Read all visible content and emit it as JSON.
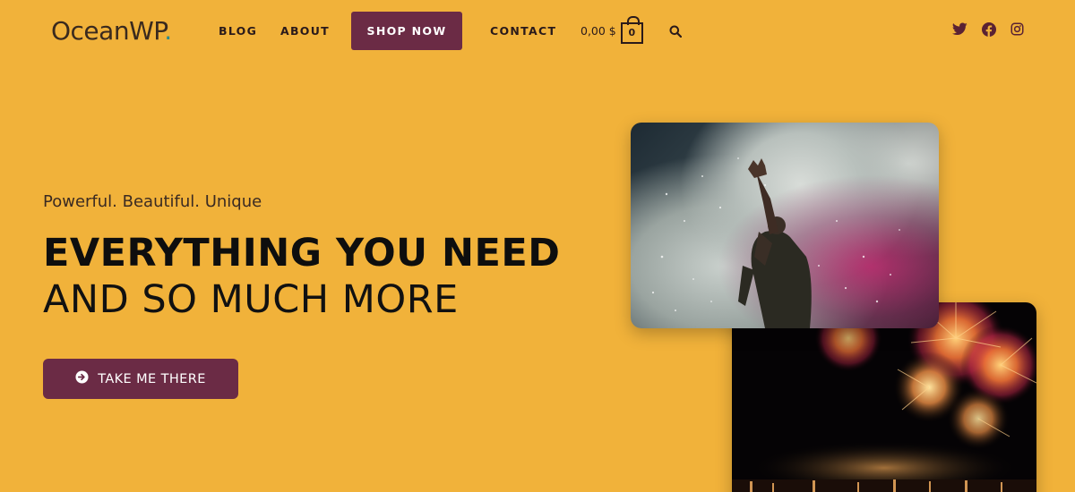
{
  "header": {
    "logo_text": "OceanWP",
    "logo_dot": ".",
    "nav": {
      "blog": "BLOG",
      "about": "ABOUT",
      "shop_now": "SHOP NOW",
      "contact": "CONTACT"
    },
    "cart": {
      "total": "0,00 $",
      "count": "0"
    },
    "icons": [
      "search-icon",
      "twitter-icon",
      "facebook-icon",
      "instagram-icon"
    ]
  },
  "hero": {
    "tagline": "Powerful. Beautiful. Unique",
    "headline_bold": "EVERYTHING YOU NEED",
    "headline_light": "AND SO MUCH MORE",
    "cta_label": "TAKE ME THERE",
    "cta_icon": "arrow-circle-right-icon"
  },
  "images": {
    "concert": "concert-photo",
    "fireworks": "fireworks-photo"
  },
  "colors": {
    "background": "#F1B23A",
    "accent": "#6B2B45",
    "text": "#111111"
  }
}
